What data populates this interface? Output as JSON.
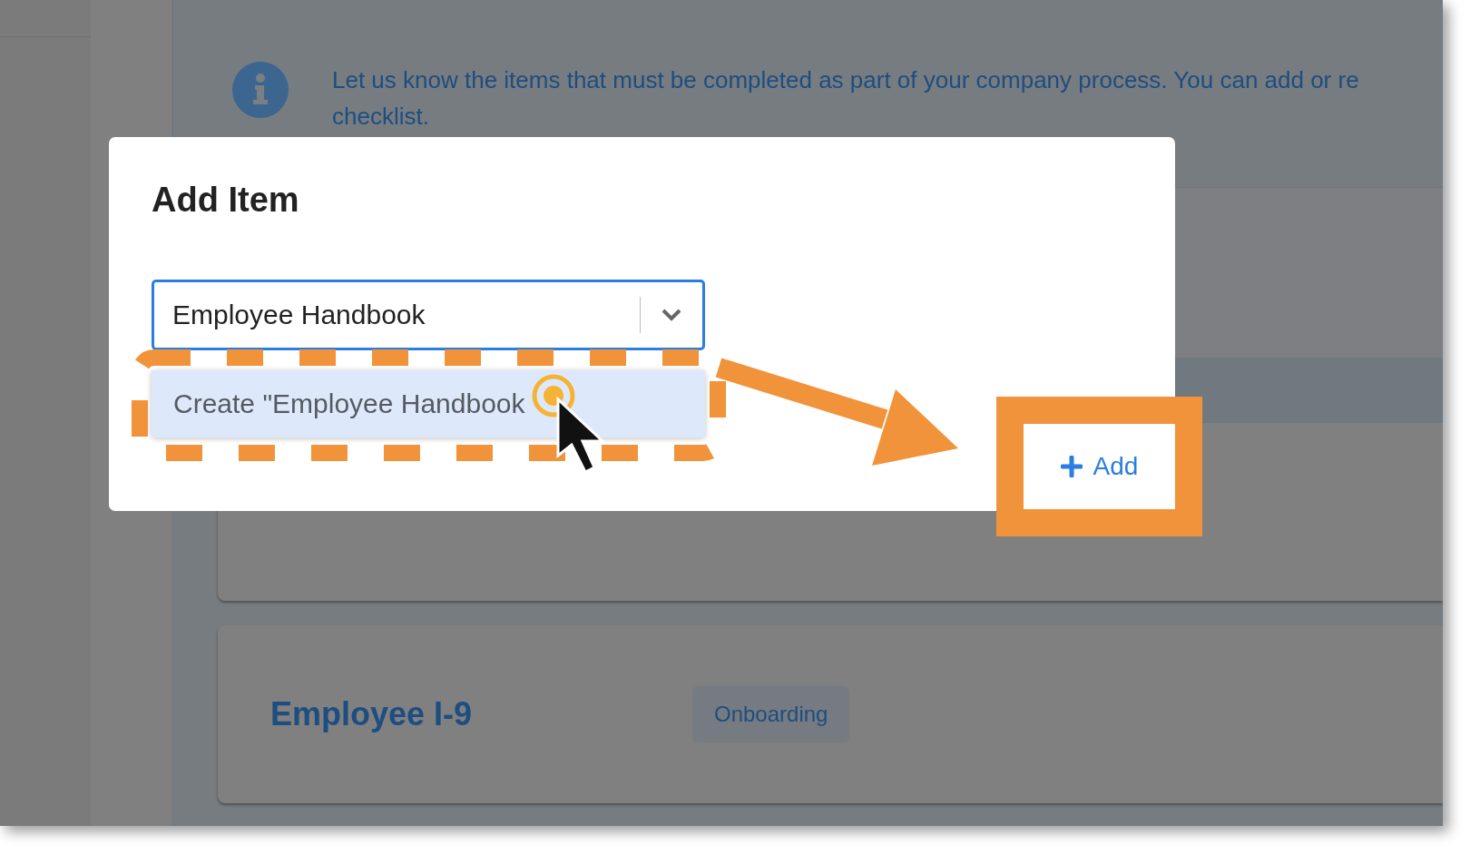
{
  "info_banner": {
    "lines": [
      "Let us know the items that must be completed as part of your company process. You can add or re",
      "checklist."
    ]
  },
  "checklist_items": [
    {
      "title": "Employee I-9",
      "tag": "Onboarding"
    }
  ],
  "dialog": {
    "title": "Add Item",
    "select": {
      "value": "Employee Handbook",
      "expanded": true
    },
    "options": [
      {
        "label": "Create \"Employee Handbook",
        "selected": true
      }
    ],
    "buttons": [
      {
        "label": "Add"
      }
    ]
  }
}
